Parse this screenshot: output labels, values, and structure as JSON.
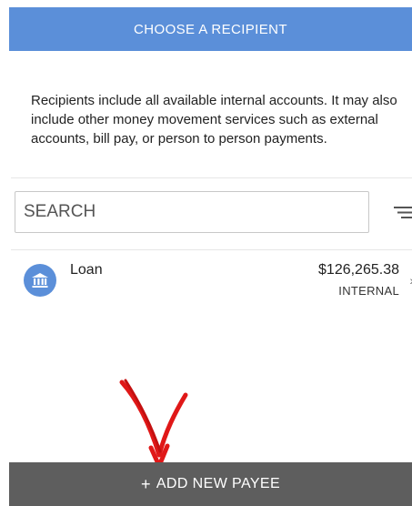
{
  "header": {
    "title": "CHOOSE A RECIPIENT"
  },
  "description": "Recipients include all available internal accounts. It may also include other money movement services such as external accounts, bill pay, or person to person payments.",
  "search": {
    "placeholder": "SEARCH",
    "value": ""
  },
  "recipients": [
    {
      "name": "Loan",
      "amount": "$126,265.38",
      "type": "INTERNAL",
      "icon": "bank-icon"
    }
  ],
  "footer": {
    "plus": "+",
    "add_label": "ADD NEW PAYEE"
  },
  "icons": {
    "filter": "filter-icon",
    "annotation": "red-arrow-annotation"
  },
  "colors": {
    "accent": "#5b8fd9",
    "footer": "#5e5e5e",
    "annotation": "#e01818"
  }
}
